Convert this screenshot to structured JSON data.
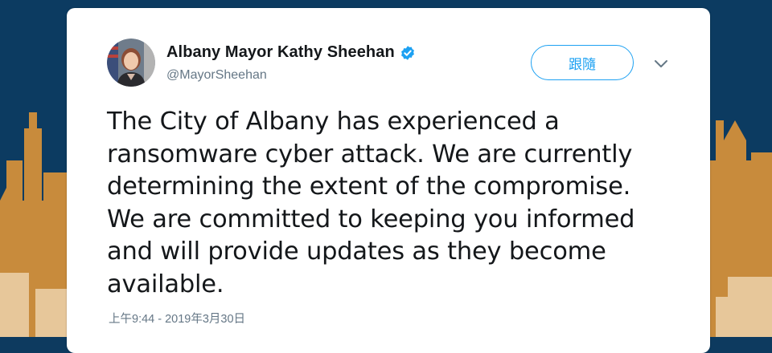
{
  "tweet": {
    "author": {
      "display_name": "Albany Mayor Kathy Sheehan",
      "handle": "@MayorSheehan",
      "verified": true,
      "verified_color": "#1da1f2"
    },
    "follow_button_label": "跟隨",
    "text": "The City of Albany has experienced a ransomware cyber attack. We are currently determining the extent of the compromise. We are committed to keeping you informed and will provide updates as they become available.",
    "timestamp": "上午9:44 - 2019年3月30日"
  },
  "colors": {
    "background": "#0c3b61",
    "skyline": "#c98a3a",
    "accent": "#1da1f2",
    "text_primary": "#14171a",
    "text_secondary": "#657786"
  },
  "icons": {
    "verified": "verified-badge-icon",
    "caret": "chevron-down-icon"
  }
}
